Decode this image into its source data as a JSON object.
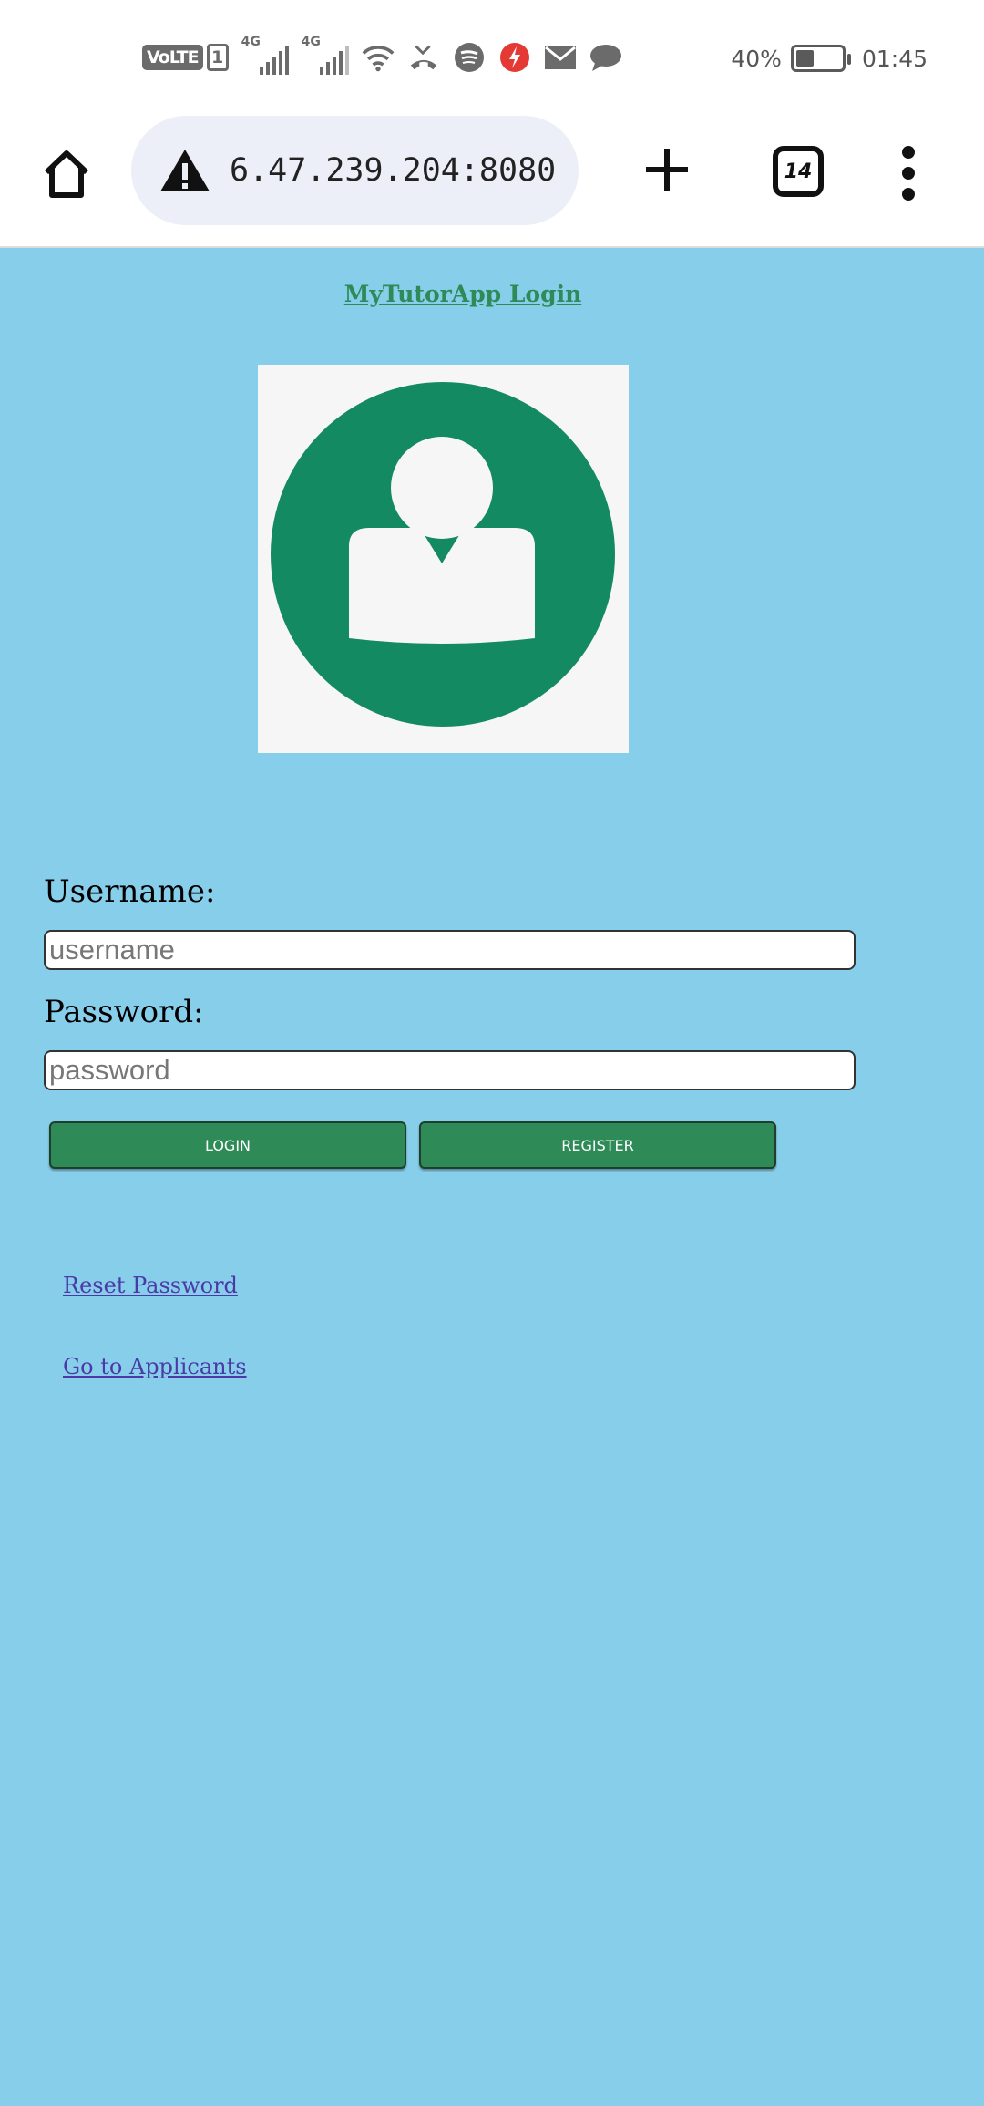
{
  "status_bar": {
    "volte": "VoLTE",
    "sim": "1",
    "net1": "4G",
    "net2": "4G",
    "battery_pct_text": "40%",
    "battery_level": 0.4,
    "time": "01:45",
    "icons": [
      "signal-icon",
      "wifi-icon",
      "missed-call-icon",
      "spotify-icon",
      "flash-icon",
      "mail-icon",
      "message-icon"
    ]
  },
  "browser": {
    "url": "6.47.239.204:8080",
    "tab_count": "14",
    "icons": [
      "home-icon",
      "warning-icon",
      "plus-icon",
      "tabs-icon",
      "more-icon"
    ]
  },
  "page": {
    "title": "MyTutorApp Login",
    "username_label": "Username:",
    "username_placeholder": "username",
    "password_label": "Password:",
    "password_placeholder": "password",
    "login_button": "LOGIN",
    "register_button": "REGISTER",
    "reset_link": "Reset Password",
    "applicants_link": "Go to Applicants"
  },
  "colors": {
    "page_bg": "#87ceeb",
    "accent_green": "#2e8b57",
    "avatar_green": "#138a62",
    "link": "#4b3aa6"
  }
}
